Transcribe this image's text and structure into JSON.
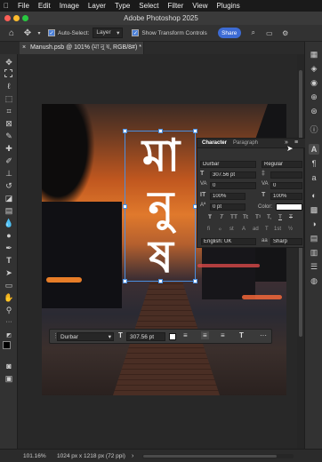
{
  "menubar": {
    "items": [
      "File",
      "Edit",
      "Image",
      "Layer",
      "Type",
      "Select",
      "Filter",
      "View",
      "Plugins"
    ]
  },
  "window": {
    "title": "Adobe Photoshop 2025"
  },
  "options_bar": {
    "auto_select_label": "Auto-Select:",
    "auto_select_value": "Layer",
    "transform_controls_label": "Show Transform Controls",
    "share_label": "Share"
  },
  "document": {
    "tab_title": "Manush.psb @ 101% (মা নু ষ, RGB/8#) *"
  },
  "artwork": {
    "glyphs": [
      "মা",
      "নু",
      "ষ"
    ]
  },
  "character_panel": {
    "tabs": [
      "Character",
      "Paragraph"
    ],
    "font_family": "Durbar",
    "font_style": "Regular",
    "font_size": "307.56 pt",
    "leading": "",
    "kerning": "0",
    "tracking": "0",
    "vertical_scale": "100%",
    "horizontal_scale": "100%",
    "baseline_shift": "0 pt",
    "color_label": "Color:",
    "language": "English: UK",
    "anti_alias": "Sharp",
    "style_buttons": [
      "T",
      "T",
      "TT",
      "Tt",
      "T¹",
      "T,",
      "T",
      "T"
    ],
    "opentype_buttons": [
      "fi",
      "ℴ",
      "st",
      "A",
      "ad",
      "T",
      "1st",
      "½"
    ]
  },
  "context_bar": {
    "font_family": "Durbar",
    "font_size": "307.56 pt",
    "more": "···"
  },
  "status": {
    "zoom": "101.16%",
    "doc_info": "1024 px x 1218 px (72 ppi)"
  },
  "colors": {
    "accent": "#3d6bd4",
    "selection": "#4a8fe0",
    "text_fill": "#ffffff"
  }
}
